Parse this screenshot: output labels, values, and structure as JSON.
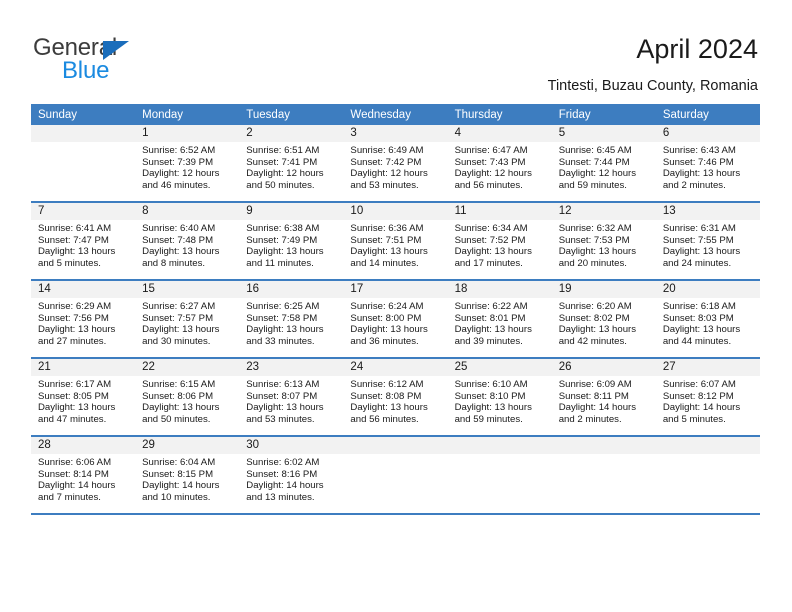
{
  "brand": {
    "name_part1": "General",
    "name_part2": "Blue",
    "triangle_color": "#1a6dbb",
    "blue_color": "#1a8ae0"
  },
  "header": {
    "title": "April 2024",
    "subtitle": "Tintesti, Buzau County, Romania"
  },
  "theme": {
    "header_blue": "#3d7dc0",
    "daynum_band": "#f2f2f2",
    "text": "#1a1a1a"
  },
  "calendar": {
    "weekday_headers": [
      "Sunday",
      "Monday",
      "Tuesday",
      "Wednesday",
      "Thursday",
      "Friday",
      "Saturday"
    ],
    "weeks": [
      [
        {
          "day": "",
          "sunrise": "",
          "sunset": "",
          "daylight1": "",
          "daylight2": "",
          "blank": true
        },
        {
          "day": "1",
          "sunrise": "Sunrise: 6:52 AM",
          "sunset": "Sunset: 7:39 PM",
          "daylight1": "Daylight: 12 hours",
          "daylight2": "and 46 minutes."
        },
        {
          "day": "2",
          "sunrise": "Sunrise: 6:51 AM",
          "sunset": "Sunset: 7:41 PM",
          "daylight1": "Daylight: 12 hours",
          "daylight2": "and 50 minutes."
        },
        {
          "day": "3",
          "sunrise": "Sunrise: 6:49 AM",
          "sunset": "Sunset: 7:42 PM",
          "daylight1": "Daylight: 12 hours",
          "daylight2": "and 53 minutes."
        },
        {
          "day": "4",
          "sunrise": "Sunrise: 6:47 AM",
          "sunset": "Sunset: 7:43 PM",
          "daylight1": "Daylight: 12 hours",
          "daylight2": "and 56 minutes."
        },
        {
          "day": "5",
          "sunrise": "Sunrise: 6:45 AM",
          "sunset": "Sunset: 7:44 PM",
          "daylight1": "Daylight: 12 hours",
          "daylight2": "and 59 minutes."
        },
        {
          "day": "6",
          "sunrise": "Sunrise: 6:43 AM",
          "sunset": "Sunset: 7:46 PM",
          "daylight1": "Daylight: 13 hours",
          "daylight2": "and 2 minutes."
        }
      ],
      [
        {
          "day": "7",
          "sunrise": "Sunrise: 6:41 AM",
          "sunset": "Sunset: 7:47 PM",
          "daylight1": "Daylight: 13 hours",
          "daylight2": "and 5 minutes."
        },
        {
          "day": "8",
          "sunrise": "Sunrise: 6:40 AM",
          "sunset": "Sunset: 7:48 PM",
          "daylight1": "Daylight: 13 hours",
          "daylight2": "and 8 minutes."
        },
        {
          "day": "9",
          "sunrise": "Sunrise: 6:38 AM",
          "sunset": "Sunset: 7:49 PM",
          "daylight1": "Daylight: 13 hours",
          "daylight2": "and 11 minutes."
        },
        {
          "day": "10",
          "sunrise": "Sunrise: 6:36 AM",
          "sunset": "Sunset: 7:51 PM",
          "daylight1": "Daylight: 13 hours",
          "daylight2": "and 14 minutes."
        },
        {
          "day": "11",
          "sunrise": "Sunrise: 6:34 AM",
          "sunset": "Sunset: 7:52 PM",
          "daylight1": "Daylight: 13 hours",
          "daylight2": "and 17 minutes."
        },
        {
          "day": "12",
          "sunrise": "Sunrise: 6:32 AM",
          "sunset": "Sunset: 7:53 PM",
          "daylight1": "Daylight: 13 hours",
          "daylight2": "and 20 minutes."
        },
        {
          "day": "13",
          "sunrise": "Sunrise: 6:31 AM",
          "sunset": "Sunset: 7:55 PM",
          "daylight1": "Daylight: 13 hours",
          "daylight2": "and 24 minutes."
        }
      ],
      [
        {
          "day": "14",
          "sunrise": "Sunrise: 6:29 AM",
          "sunset": "Sunset: 7:56 PM",
          "daylight1": "Daylight: 13 hours",
          "daylight2": "and 27 minutes."
        },
        {
          "day": "15",
          "sunrise": "Sunrise: 6:27 AM",
          "sunset": "Sunset: 7:57 PM",
          "daylight1": "Daylight: 13 hours",
          "daylight2": "and 30 minutes."
        },
        {
          "day": "16",
          "sunrise": "Sunrise: 6:25 AM",
          "sunset": "Sunset: 7:58 PM",
          "daylight1": "Daylight: 13 hours",
          "daylight2": "and 33 minutes."
        },
        {
          "day": "17",
          "sunrise": "Sunrise: 6:24 AM",
          "sunset": "Sunset: 8:00 PM",
          "daylight1": "Daylight: 13 hours",
          "daylight2": "and 36 minutes."
        },
        {
          "day": "18",
          "sunrise": "Sunrise: 6:22 AM",
          "sunset": "Sunset: 8:01 PM",
          "daylight1": "Daylight: 13 hours",
          "daylight2": "and 39 minutes."
        },
        {
          "day": "19",
          "sunrise": "Sunrise: 6:20 AM",
          "sunset": "Sunset: 8:02 PM",
          "daylight1": "Daylight: 13 hours",
          "daylight2": "and 42 minutes."
        },
        {
          "day": "20",
          "sunrise": "Sunrise: 6:18 AM",
          "sunset": "Sunset: 8:03 PM",
          "daylight1": "Daylight: 13 hours",
          "daylight2": "and 44 minutes."
        }
      ],
      [
        {
          "day": "21",
          "sunrise": "Sunrise: 6:17 AM",
          "sunset": "Sunset: 8:05 PM",
          "daylight1": "Daylight: 13 hours",
          "daylight2": "and 47 minutes."
        },
        {
          "day": "22",
          "sunrise": "Sunrise: 6:15 AM",
          "sunset": "Sunset: 8:06 PM",
          "daylight1": "Daylight: 13 hours",
          "daylight2": "and 50 minutes."
        },
        {
          "day": "23",
          "sunrise": "Sunrise: 6:13 AM",
          "sunset": "Sunset: 8:07 PM",
          "daylight1": "Daylight: 13 hours",
          "daylight2": "and 53 minutes."
        },
        {
          "day": "24",
          "sunrise": "Sunrise: 6:12 AM",
          "sunset": "Sunset: 8:08 PM",
          "daylight1": "Daylight: 13 hours",
          "daylight2": "and 56 minutes."
        },
        {
          "day": "25",
          "sunrise": "Sunrise: 6:10 AM",
          "sunset": "Sunset: 8:10 PM",
          "daylight1": "Daylight: 13 hours",
          "daylight2": "and 59 minutes."
        },
        {
          "day": "26",
          "sunrise": "Sunrise: 6:09 AM",
          "sunset": "Sunset: 8:11 PM",
          "daylight1": "Daylight: 14 hours",
          "daylight2": "and 2 minutes."
        },
        {
          "day": "27",
          "sunrise": "Sunrise: 6:07 AM",
          "sunset": "Sunset: 8:12 PM",
          "daylight1": "Daylight: 14 hours",
          "daylight2": "and 5 minutes."
        }
      ],
      [
        {
          "day": "28",
          "sunrise": "Sunrise: 6:06 AM",
          "sunset": "Sunset: 8:14 PM",
          "daylight1": "Daylight: 14 hours",
          "daylight2": "and 7 minutes."
        },
        {
          "day": "29",
          "sunrise": "Sunrise: 6:04 AM",
          "sunset": "Sunset: 8:15 PM",
          "daylight1": "Daylight: 14 hours",
          "daylight2": "and 10 minutes."
        },
        {
          "day": "30",
          "sunrise": "Sunrise: 6:02 AM",
          "sunset": "Sunset: 8:16 PM",
          "daylight1": "Daylight: 14 hours",
          "daylight2": "and 13 minutes."
        },
        {
          "day": "",
          "sunrise": "",
          "sunset": "",
          "daylight1": "",
          "daylight2": "",
          "blank": true
        },
        {
          "day": "",
          "sunrise": "",
          "sunset": "",
          "daylight1": "",
          "daylight2": "",
          "blank": true
        },
        {
          "day": "",
          "sunrise": "",
          "sunset": "",
          "daylight1": "",
          "daylight2": "",
          "blank": true
        },
        {
          "day": "",
          "sunrise": "",
          "sunset": "",
          "daylight1": "",
          "daylight2": "",
          "blank": true
        }
      ]
    ]
  }
}
